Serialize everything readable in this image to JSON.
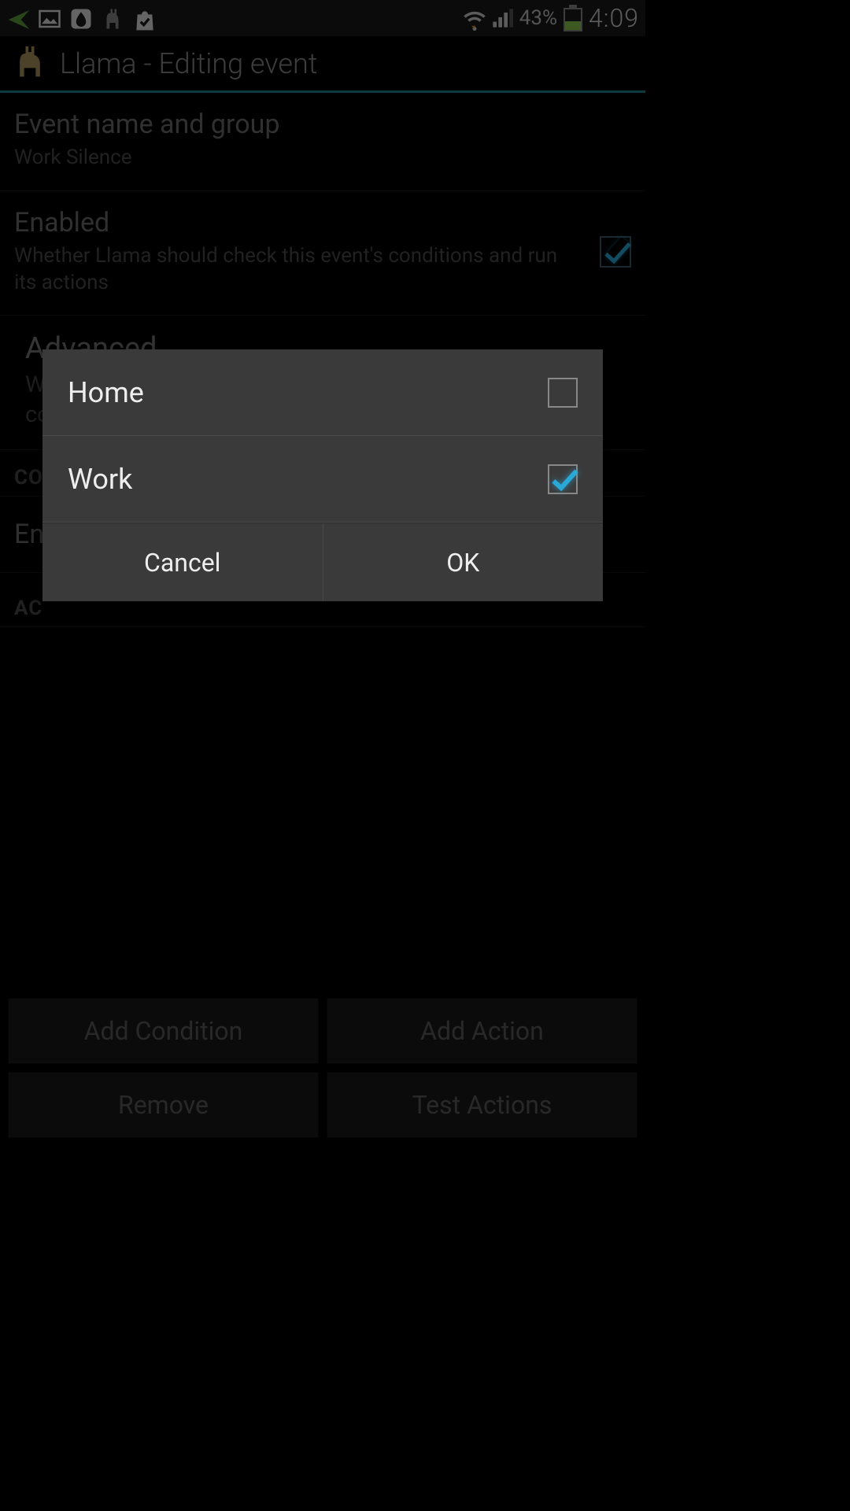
{
  "status_bar": {
    "battery_pct": "43%",
    "time": "4:09"
  },
  "header": {
    "title": "Llama - Editing event"
  },
  "settings": {
    "name_group": {
      "title": "Event name and group",
      "value": "Work Silence"
    },
    "enabled": {
      "title": "Enabled",
      "sub": "Whether Llama should check this event's conditions and run its actions",
      "checked": true
    },
    "advanced": {
      "title": "Advanced...",
      "sub": "Whether this event is delayed or repeating, requires confirmation and trigger filters"
    },
    "conditions_header": "CO",
    "enter_row": "En",
    "actions_header": "AC"
  },
  "dialog": {
    "items": [
      {
        "label": "Home",
        "checked": false
      },
      {
        "label": "Work",
        "checked": true
      }
    ],
    "cancel": "Cancel",
    "ok": "OK"
  },
  "bottom": {
    "add_condition": "Add Condition",
    "add_action": "Add Action",
    "remove": "Remove",
    "test": "Test Actions"
  }
}
